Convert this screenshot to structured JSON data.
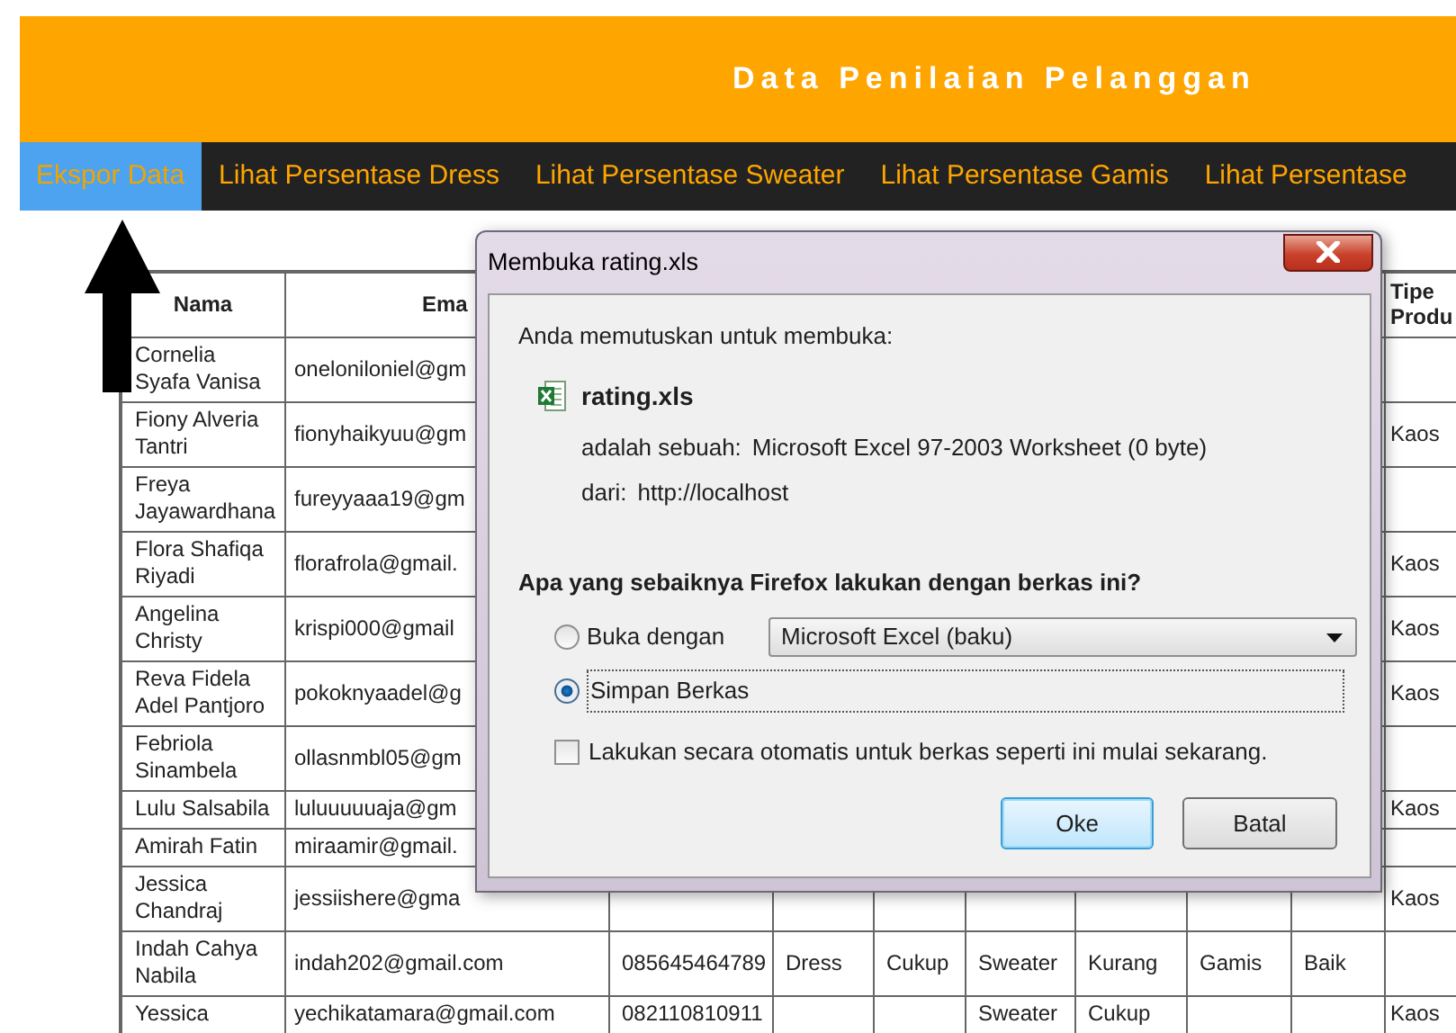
{
  "header": {
    "title": "Data Penilaian Pelanggan"
  },
  "nav": [
    {
      "label": "Ekspor Data",
      "selected": true
    },
    {
      "label": "Lihat Persentase Dress",
      "selected": false
    },
    {
      "label": "Lihat Persentase Sweater",
      "selected": false
    },
    {
      "label": "Lihat Persentase Gamis",
      "selected": false
    },
    {
      "label": "Lihat Persentase",
      "selected": false
    }
  ],
  "table": {
    "columns": [
      "Nama",
      "Ema",
      null,
      null,
      null,
      null,
      null,
      null,
      null,
      "Tipe Produ"
    ],
    "rows": [
      [
        "Cornelia Syafa Vanisa",
        "oneloniloniel@gm",
        null,
        null,
        null,
        null,
        null,
        null,
        null,
        null
      ],
      [
        "Fiony Alveria Tantri",
        "fionyhaikyuu@gm",
        null,
        null,
        null,
        null,
        null,
        null,
        null,
        "Kaos"
      ],
      [
        "Freya Jayawardhana",
        "fureyyaaa19@gm",
        null,
        null,
        null,
        null,
        null,
        null,
        null,
        null
      ],
      [
        "Flora Shafiqa Riyadi",
        "florafrola@gmail.",
        null,
        null,
        null,
        null,
        null,
        null,
        null,
        "Kaos"
      ],
      [
        "Angelina Christy",
        "krispi000@gmail",
        null,
        null,
        null,
        null,
        null,
        null,
        null,
        "Kaos"
      ],
      [
        "Reva Fidela Adel Pantjoro",
        "pokoknyaadel@g",
        null,
        null,
        null,
        null,
        null,
        null,
        null,
        "Kaos"
      ],
      [
        "Febriola Sinambela",
        "ollasnmbl05@gm",
        null,
        null,
        null,
        null,
        null,
        null,
        null,
        null
      ],
      [
        "Lulu Salsabila",
        "luluuuuuaja@gm",
        null,
        null,
        null,
        null,
        null,
        null,
        null,
        "Kaos"
      ],
      [
        "Amirah Fatin",
        "miraamir@gmail.",
        null,
        null,
        null,
        null,
        null,
        null,
        null,
        null
      ],
      [
        "Jessica Chandraj",
        "jessiishere@gma",
        null,
        null,
        null,
        null,
        null,
        null,
        null,
        "Kaos"
      ],
      [
        "Indah Cahya Nabila",
        "indah202@gmail.com",
        "085645464789",
        "Dress",
        "Cukup",
        "Sweater",
        "Kurang",
        "Gamis",
        "Baik",
        null
      ],
      [
        "Yessica",
        "yechikatamara@gmail.com",
        "082110810911",
        null,
        null,
        "Sweater",
        "Cukup",
        null,
        null,
        "Kaos"
      ]
    ]
  },
  "dialog": {
    "title": "Membuka rating.xls",
    "intro": "Anda memutuskan untuk membuka:",
    "file_name": "rating.xls",
    "details": [
      {
        "label": "adalah sebuah:",
        "value": "Microsoft Excel 97-2003 Worksheet (0 byte)"
      },
      {
        "label": "dari:",
        "value": "http://localhost"
      }
    ],
    "question": "Apa yang sebaiknya Firefox lakukan dengan berkas ini?",
    "options": [
      {
        "label": "Buka dengan",
        "selected": false,
        "app": "Microsoft Excel (baku)"
      },
      {
        "label": "Simpan Berkas",
        "selected": true
      }
    ],
    "remember": {
      "label": "Lakukan secara otomatis untuk berkas seperti ini mulai sekarang.",
      "checked": false
    },
    "buttons": [
      {
        "label": "Oke",
        "focused": true
      },
      {
        "label": "Batal",
        "focused": false
      }
    ]
  }
}
